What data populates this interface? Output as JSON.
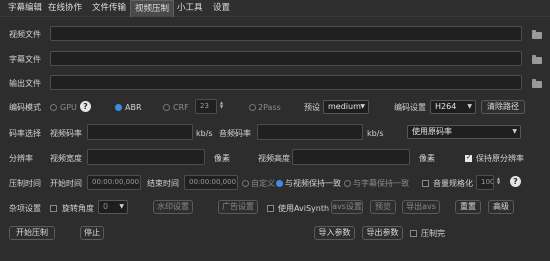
{
  "menu": {
    "items": [
      {
        "label": "字幕编辑"
      },
      {
        "label": "在线协作"
      },
      {
        "label": "文件传输"
      },
      {
        "label": "视频压制"
      },
      {
        "label": "小工具"
      },
      {
        "label": "设置"
      }
    ],
    "active": "视频压制"
  },
  "files": {
    "video_label": "视频文件",
    "video_value": "",
    "subtitle_label": "字幕文件",
    "subtitle_value": "",
    "output_label": "输出文件",
    "output_value": ""
  },
  "encode": {
    "mode_label": "编码模式",
    "gpu_label": "GPU",
    "abr_label": "ABR",
    "crf_label": "CRF",
    "crf_value": "23",
    "twopass_label": "2Pass",
    "preset_label": "预设",
    "preset_value": "medium",
    "settings_label": "编码设置",
    "codec_value": "H264",
    "clear_path_label": "清除路径",
    "selected_mode": "ABR"
  },
  "bitrate": {
    "select_label": "码率选择",
    "video_bitrate_label": "视频码率",
    "video_unit": "kb/s",
    "audio_bitrate_label": "音频码率",
    "audio_unit": "kb/s",
    "audio_option": "使用原码率"
  },
  "resolution": {
    "label": "分辨率",
    "width_label": "视频宽度",
    "width_unit": "像素",
    "height_label": "视频高度",
    "height_unit": "像素",
    "keep_original_label": "保持原分辨率",
    "keep_original": true
  },
  "time": {
    "label": "压制时间",
    "start_label": "开始时间",
    "start_value": "00:00:00,000",
    "end_label": "结束时间",
    "end_value": "00:00:00,000",
    "custom_label": "自定义",
    "same_video_label": "与视频保持一致",
    "same_subtitle_label": "与字幕保持一致",
    "volume_label": "音量规格化",
    "volume_value": "100",
    "selected": "与视频保持一致"
  },
  "misc": {
    "label": "杂项设置",
    "rotate_label": "旋转角度",
    "rotate_value": "0",
    "watermark_label": "水印设置",
    "ad_label": "广告设置",
    "avisynth_label": "使用AviSynth",
    "avs_settings_label": "avs设置",
    "preview_label": "预览",
    "export_avs_label": "导出avs",
    "reset_label": "重置",
    "advanced_label": "高级"
  },
  "actions": {
    "start_label": "开始压制",
    "stop_label": "停止",
    "import_label": "导入参数",
    "export_label": "导出参数",
    "after_label": "压制完"
  },
  "colors": {
    "background": "#2b2b2b",
    "accent": "#3a8ee6"
  }
}
